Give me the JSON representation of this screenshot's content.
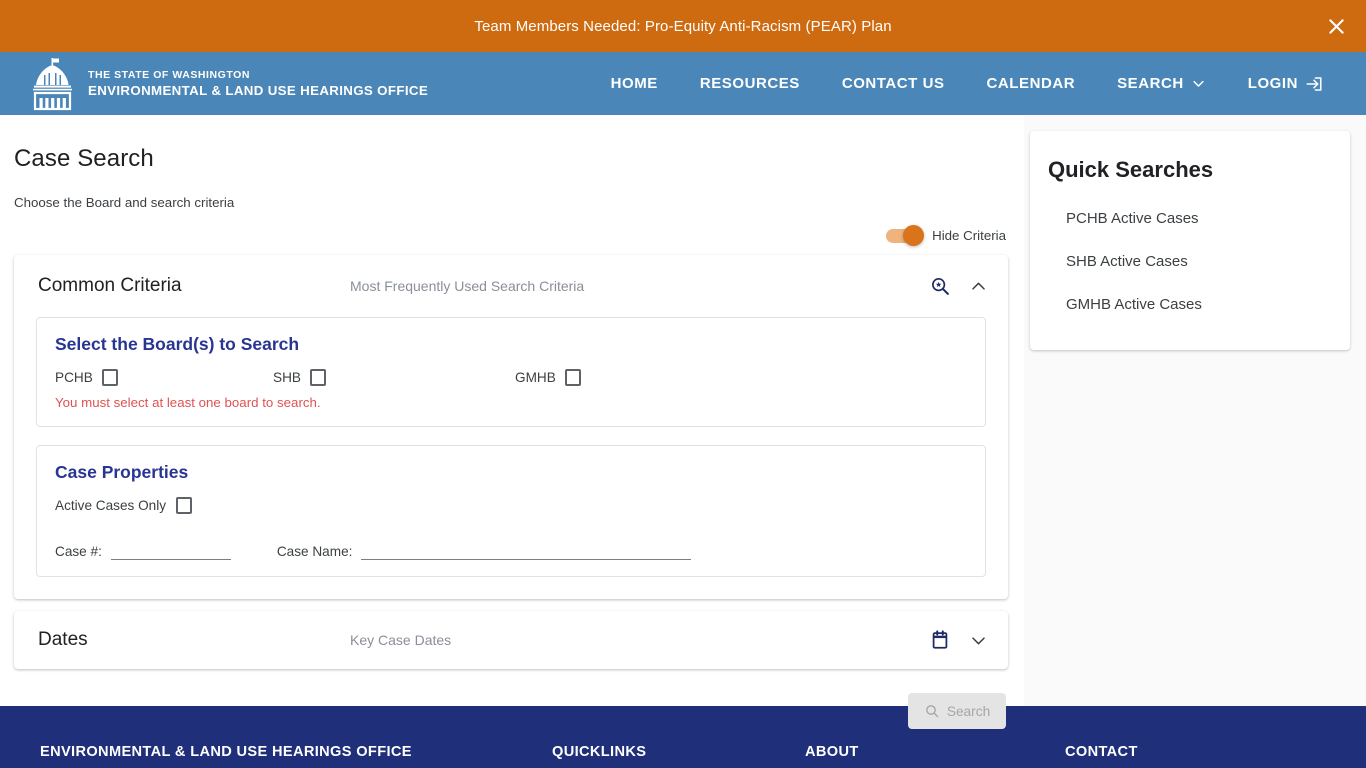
{
  "alert_banner": {
    "text": "Team Members Needed: Pro-Equity Anti-Racism (PEAR) Plan",
    "close_icon": "close-icon",
    "background": "#ce6a10",
    "text_color": "#ffffff"
  },
  "nav": {
    "background": "#4a87b8",
    "logo_icon": "capitol-dome-icon",
    "brand_line1": "THE STATE OF WASHINGTON",
    "brand_line2": "ENVIRONMENTAL & LAND USE HEARINGS OFFICE",
    "links": [
      {
        "label": "HOME",
        "icon": null
      },
      {
        "label": "RESOURCES",
        "icon": null
      },
      {
        "label": "CONTACT US",
        "icon": null
      },
      {
        "label": "CALENDAR",
        "icon": null
      },
      {
        "label": "SEARCH",
        "icon": "chevron-down-icon"
      },
      {
        "label": "LOGIN",
        "icon": "login-arrow-icon"
      }
    ]
  },
  "main": {
    "title": "Case Search",
    "subtitle": "Choose the Board and search criteria",
    "hide_criteria": {
      "label": "Hide Criteria",
      "state": "on",
      "accent": "#d9741a"
    },
    "common_criteria": {
      "title": "Common Criteria",
      "hint": "Most Frequently Used Search Criteria",
      "search_icon": "magnifier-star-icon",
      "collapse_icon": "chevron-up-icon",
      "boards": {
        "title": "Select the Board(s) to Search",
        "options": [
          {
            "label": "PCHB",
            "checked": false
          },
          {
            "label": "SHB",
            "checked": false
          },
          {
            "label": "GMHB",
            "checked": false
          }
        ],
        "error": "You must select at least one board to search.",
        "error_color": "#e05252"
      },
      "case_properties": {
        "title": "Case Properties",
        "active_only_label": "Active Cases Only",
        "active_only_checked": false,
        "case_number": {
          "label": "Case #:",
          "value": "",
          "placeholder": ""
        },
        "case_name": {
          "label": "Case Name:",
          "value": "",
          "placeholder": ""
        }
      }
    },
    "dates": {
      "title": "Dates",
      "hint": "Key Case Dates",
      "calendar_icon": "calendar-icon",
      "expand_icon": "chevron-down-icon"
    },
    "search_button": {
      "label": "Search",
      "icon": "search-icon",
      "disabled": true
    }
  },
  "sidebar": {
    "title": "Quick Searches",
    "items": [
      {
        "label": "PCHB Active Cases"
      },
      {
        "label": "SHB Active Cases"
      },
      {
        "label": "GMHB Active Cases"
      }
    ]
  },
  "footer": {
    "background": "#1f2f7a",
    "columns": [
      {
        "heading": "ENVIRONMENTAL & LAND USE HEARINGS OFFICE"
      },
      {
        "heading": "QUICKLINKS"
      },
      {
        "heading": "ABOUT"
      },
      {
        "heading": "CONTACT"
      }
    ]
  }
}
